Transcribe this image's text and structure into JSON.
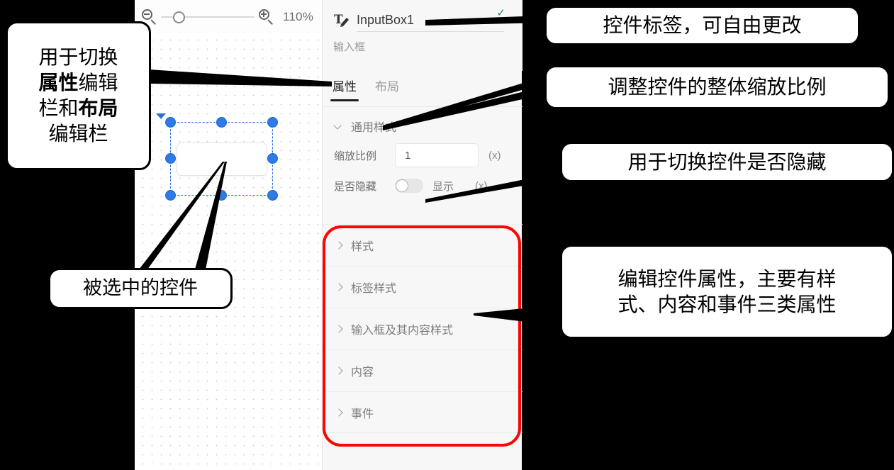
{
  "toolbar": {
    "zoom_out_icon": "zoom-out-icon",
    "zoom_in_icon": "zoom-in-icon",
    "zoom_percent": "110%",
    "slider_value": 110
  },
  "panel": {
    "widget_name": "InputBox1",
    "widget_name_icon": "text-edit-icon",
    "confirm_check": "✓",
    "widget_type": "输入框",
    "tabs": [
      {
        "label": "属性",
        "active": true
      },
      {
        "label": "布局",
        "active": false
      }
    ],
    "general_group": {
      "title": "通用样式",
      "expanded": true,
      "scale": {
        "label": "缩放比例",
        "value": "1",
        "unit": "(x)"
      },
      "hidden": {
        "label": "是否隐藏",
        "state": "显示",
        "toggle_on": false,
        "unit": "(x)"
      }
    },
    "sections": [
      {
        "label": "样式",
        "expanded": false
      },
      {
        "label": "标签样式",
        "expanded": false
      },
      {
        "label": "输入框及其内容样式",
        "expanded": false
      },
      {
        "label": "内容",
        "expanded": false
      },
      {
        "label": "事件",
        "expanded": false
      }
    ]
  },
  "canvas": {
    "selected_widget": "InputBox1",
    "selection_handles": 8
  },
  "annotations": {
    "tabs_note_line1": "用于切换",
    "tabs_note_bold1": "属性",
    "tabs_note_mid1": "编辑",
    "tabs_note_line3a": "栏和",
    "tabs_note_bold2": "布局",
    "tabs_note_line4": "编辑栏",
    "selected_note": "被选中的控件",
    "label_note": "控件标签，可自由更改",
    "scale_note": "调整控件的整体缩放比例",
    "hide_note": "用于切换控件是否隐藏",
    "props_note_line1": "编辑控件属性，主要有样",
    "props_note_line2": "式、内容和事件三类属性"
  },
  "colors": {
    "highlight": "#fb0505",
    "selection": "#2f7ae5",
    "check": "#1f8a58",
    "panel_bg": "#f7f7f7"
  }
}
